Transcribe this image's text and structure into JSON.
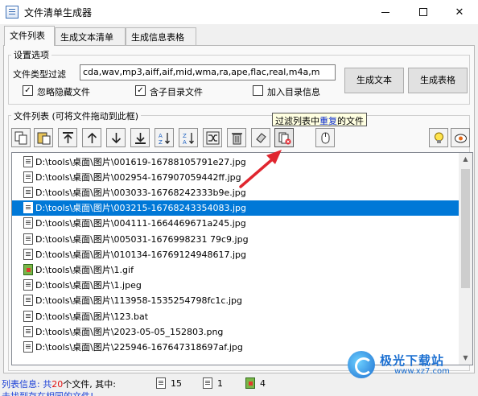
{
  "window": {
    "title": "文件清单生成器"
  },
  "tabs": [
    {
      "label": "文件列表",
      "active": true
    },
    {
      "label": "生成文本清单",
      "active": false
    },
    {
      "label": "生成信息表格",
      "active": false
    }
  ],
  "settings": {
    "group_title": "设置选项",
    "filter_label": "文件类型过滤",
    "filter_value": "cda,wav,mp3,aiff,aif,mid,wma,ra,ape,flac,real,m4a,m",
    "checkboxes": [
      {
        "label": "忽略隐藏文件",
        "checked": true
      },
      {
        "label": "含子目录文件",
        "checked": true
      },
      {
        "label": "加入目录信息",
        "checked": false
      }
    ],
    "generate_text_button": "生成文本",
    "generate_table_button": "生成表格"
  },
  "file_list": {
    "group_title": "文件列表 (可将文件拖动到此框)",
    "tooltip_prefix": "过滤列表中",
    "tooltip_highlight": "重复",
    "tooltip_suffix": "的文件",
    "toolbar_icons": [
      "copy-icon",
      "paste-icon",
      "move-top-icon",
      "move-up-icon",
      "move-down-icon",
      "move-bottom-icon",
      "sort-az-icon",
      "sort-za-icon",
      "shuffle-icon",
      "delete-icon",
      "clear-icon",
      "filter-duplicates-icon",
      "mouse-icon",
      "lightbulb-icon",
      "about-icon"
    ],
    "selected_index": 3,
    "rows": [
      {
        "path": "D:\\tools\\桌面\\图片\\001619-16788105791e27.jpg",
        "type": "image"
      },
      {
        "path": "D:\\tools\\桌面\\图片\\002954-167907059442ff.jpg",
        "type": "image"
      },
      {
        "path": "D:\\tools\\桌面\\图片\\003033-16768242333b9e.jpg",
        "type": "image"
      },
      {
        "path": "D:\\tools\\桌面\\图片\\003215-16768243354083.jpg",
        "type": "image"
      },
      {
        "path": "D:\\tools\\桌面\\图片\\004111-1664469671a245.jpg",
        "type": "image"
      },
      {
        "path": "D:\\tools\\桌面\\图片\\005031-1676998231 79c9.jpg",
        "type": "image"
      },
      {
        "path": "D:\\tools\\桌面\\图片\\010134-16769124948617.jpg",
        "type": "image"
      },
      {
        "path": "D:\\tools\\桌面\\图片\\1.gif",
        "type": "gif"
      },
      {
        "path": "D:\\tools\\桌面\\图片\\1.jpeg",
        "type": "image"
      },
      {
        "path": "D:\\tools\\桌面\\图片\\113958-1535254798fc1c.jpg",
        "type": "image"
      },
      {
        "path": "D:\\tools\\桌面\\图片\\123.bat",
        "type": "text"
      },
      {
        "path": "D:\\tools\\桌面\\图片\\2023-05-05_152803.png",
        "type": "image"
      },
      {
        "path": "D:\\tools\\桌面\\图片\\225946-167647318697af.jpg",
        "type": "image"
      }
    ]
  },
  "status": {
    "prefix": "列表信息: 共",
    "total": "20",
    "suffix": "个文件, 其中:",
    "counts": [
      {
        "icon": "image-file-icon",
        "value": "15"
      },
      {
        "icon": "text-file-icon",
        "value": "1"
      },
      {
        "icon": "gif-file-icon",
        "value": "4"
      }
    ],
    "line2": "未找到存在相同的文件!"
  },
  "watermark": {
    "title": "极光下载站",
    "url": "www.xz7.com"
  },
  "colors": {
    "selection": "#0078d7",
    "tooltip_bg": "#ffffe1",
    "arrow": "#e0262f",
    "status_blue": "#1a3fd6",
    "status_red": "#e01010"
  }
}
